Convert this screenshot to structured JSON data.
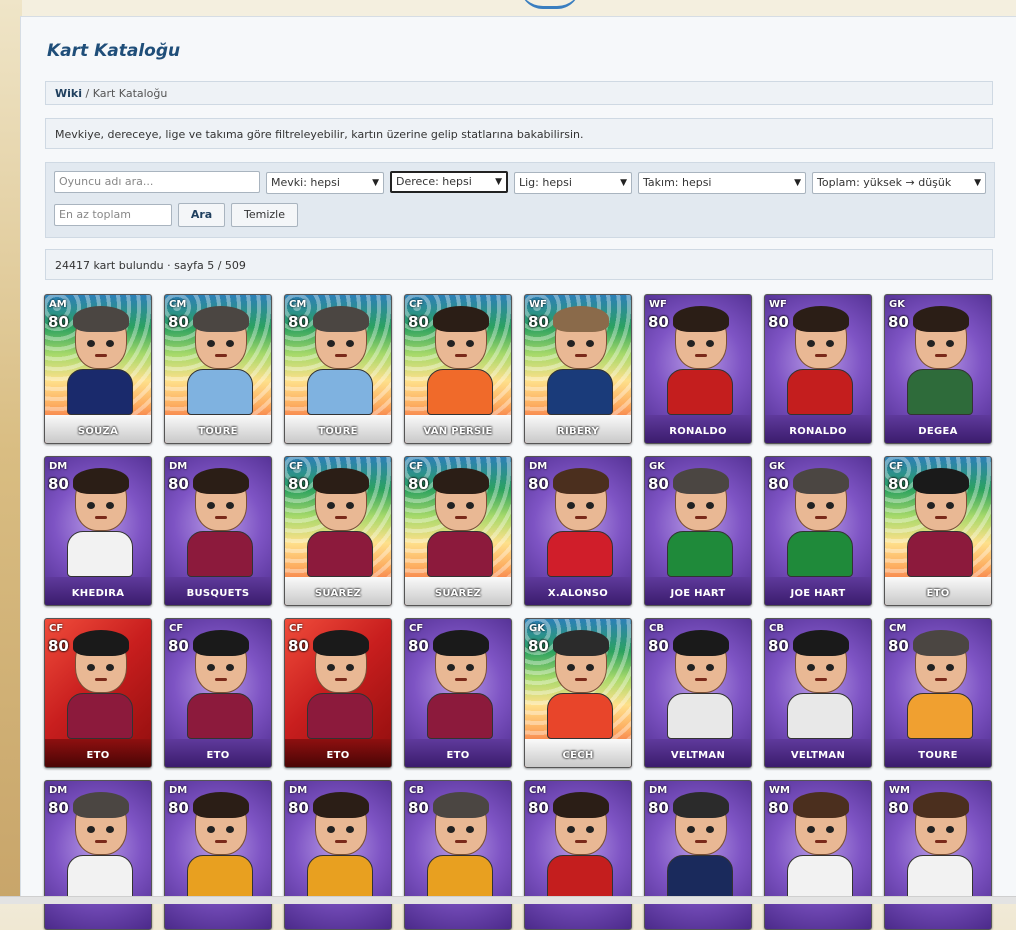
{
  "page": {
    "title": "Kart Kataloğu",
    "breadcrumb": {
      "root": "Wiki",
      "separator": "/",
      "current": "Kart Kataloğu"
    },
    "info": "Mevkiye, dereceye, lige ve takıma göre filtreleyebilir, kartın üzerine gelip statlarına bakabilirsin.",
    "result": "24417 kart bulundu · sayfa 5 / 509"
  },
  "filters": {
    "search_placeholder": "Oyuncu adı ara...",
    "position": "Mevki: hepsi",
    "grade": "Derece: hepsi",
    "league": "Lig: hepsi",
    "team": "Takım: hepsi",
    "sort": "Toplam: yüksek → düşük",
    "min_total_placeholder": "En az toplam",
    "search_button": "Ara",
    "clear_button": "Temizle"
  },
  "colors": {
    "title": "#1f4e79",
    "panel": "#f6f8fa",
    "box": "#eef2f6"
  },
  "cards": [
    {
      "pos": "AM",
      "ovr": "80",
      "name": "SOUZA",
      "style": "rainbow",
      "shirt": "#1a2a6c",
      "hair": "#4b4642"
    },
    {
      "pos": "CM",
      "ovr": "80",
      "name": "TOURE",
      "style": "rainbow",
      "shirt": "#7fb2e0",
      "hair": "#4b4642"
    },
    {
      "pos": "CM",
      "ovr": "80",
      "name": "TOURE",
      "style": "rainbow",
      "shirt": "#7fb2e0",
      "hair": "#4b4642"
    },
    {
      "pos": "CF",
      "ovr": "80",
      "name": "VAN PERSIE",
      "style": "rainbow",
      "shirt": "#f06a2a",
      "hair": "#2b1e16"
    },
    {
      "pos": "WF",
      "ovr": "80",
      "name": "RIBERY",
      "style": "rainbow",
      "shirt": "#1a3b7a",
      "hair": "#8a6a4a"
    },
    {
      "pos": "WF",
      "ovr": "80",
      "name": "RONALDO",
      "style": "purple",
      "shirt": "#c41e1e",
      "hair": "#2b1e16"
    },
    {
      "pos": "WF",
      "ovr": "80",
      "name": "RONALDO",
      "style": "purple",
      "shirt": "#c41e1e",
      "hair": "#2b1e16"
    },
    {
      "pos": "GK",
      "ovr": "80",
      "name": "DEGEA",
      "style": "purple",
      "shirt": "#2e6b3a",
      "hair": "#2b1e16"
    },
    {
      "pos": "DM",
      "ovr": "80",
      "name": "KHEDIRA",
      "style": "purple",
      "shirt": "#f2f2f2",
      "hair": "#2b1e16"
    },
    {
      "pos": "DM",
      "ovr": "80",
      "name": "BUSQUETS",
      "style": "purple",
      "shirt": "#8c1a3c",
      "hair": "#2b1e16"
    },
    {
      "pos": "CF",
      "ovr": "80",
      "name": "SUAREZ",
      "style": "rainbow",
      "shirt": "#8c1a3c",
      "hair": "#2b1e16"
    },
    {
      "pos": "CF",
      "ovr": "80",
      "name": "SUAREZ",
      "style": "rainbow",
      "shirt": "#8c1a3c",
      "hair": "#2b1e16"
    },
    {
      "pos": "DM",
      "ovr": "80",
      "name": "X.ALONSO",
      "style": "purple",
      "shirt": "#d01e2a",
      "hair": "#4b2f1e"
    },
    {
      "pos": "GK",
      "ovr": "80",
      "name": "JOE HART",
      "style": "purple",
      "shirt": "#1f8a3a",
      "hair": "#4b4642"
    },
    {
      "pos": "GK",
      "ovr": "80",
      "name": "JOE HART",
      "style": "purple",
      "shirt": "#1f8a3a",
      "hair": "#4b4642"
    },
    {
      "pos": "CF",
      "ovr": "80",
      "name": "ETO",
      "style": "rainbow",
      "shirt": "#8c1a3c",
      "hair": "#1a1a1a"
    },
    {
      "pos": "CF",
      "ovr": "80",
      "name": "ETO",
      "style": "red",
      "shirt": "#8c1a3c",
      "hair": "#1a1a1a"
    },
    {
      "pos": "CF",
      "ovr": "80",
      "name": "ETO",
      "style": "purple",
      "shirt": "#8c1a3c",
      "hair": "#1a1a1a"
    },
    {
      "pos": "CF",
      "ovr": "80",
      "name": "ETO",
      "style": "red",
      "shirt": "#8c1a3c",
      "hair": "#1a1a1a"
    },
    {
      "pos": "CF",
      "ovr": "80",
      "name": "ETO",
      "style": "purple",
      "shirt": "#8c1a3c",
      "hair": "#1a1a1a"
    },
    {
      "pos": "GK",
      "ovr": "80",
      "name": "CECH",
      "style": "rainbow",
      "shirt": "#e8452a",
      "hair": "#2b2b2b"
    },
    {
      "pos": "CB",
      "ovr": "80",
      "name": "VELTMAN",
      "style": "purple",
      "shirt": "#e8e8e8",
      "hair": "#1a1a1a"
    },
    {
      "pos": "CB",
      "ovr": "80",
      "name": "VELTMAN",
      "style": "purple",
      "shirt": "#e8e8e8",
      "hair": "#1a1a1a"
    },
    {
      "pos": "CM",
      "ovr": "80",
      "name": "TOURE",
      "style": "purple",
      "shirt": "#f0a030",
      "hair": "#4b4642"
    },
    {
      "pos": "DM",
      "ovr": "80",
      "name": "",
      "style": "purple",
      "shirt": "#f2f2f2",
      "hair": "#4b4642"
    },
    {
      "pos": "DM",
      "ovr": "80",
      "name": "",
      "style": "purple",
      "shirt": "#e8a020",
      "hair": "#2b1e16"
    },
    {
      "pos": "DM",
      "ovr": "80",
      "name": "",
      "style": "purple",
      "shirt": "#e8a020",
      "hair": "#2b1e16"
    },
    {
      "pos": "CB",
      "ovr": "80",
      "name": "",
      "style": "purple",
      "shirt": "#e8a020",
      "hair": "#4b4642"
    },
    {
      "pos": "CM",
      "ovr": "80",
      "name": "",
      "style": "purple",
      "shirt": "#c41e1e",
      "hair": "#2b1e16"
    },
    {
      "pos": "DM",
      "ovr": "80",
      "name": "",
      "style": "purple",
      "shirt": "#1a2a5c",
      "hair": "#2b2b2b"
    },
    {
      "pos": "WM",
      "ovr": "80",
      "name": "",
      "style": "purple",
      "shirt": "#f2f2f2",
      "hair": "#4b2f1e"
    },
    {
      "pos": "WM",
      "ovr": "80",
      "name": "",
      "style": "purple",
      "shirt": "#f2f2f2",
      "hair": "#4b2f1e"
    }
  ]
}
